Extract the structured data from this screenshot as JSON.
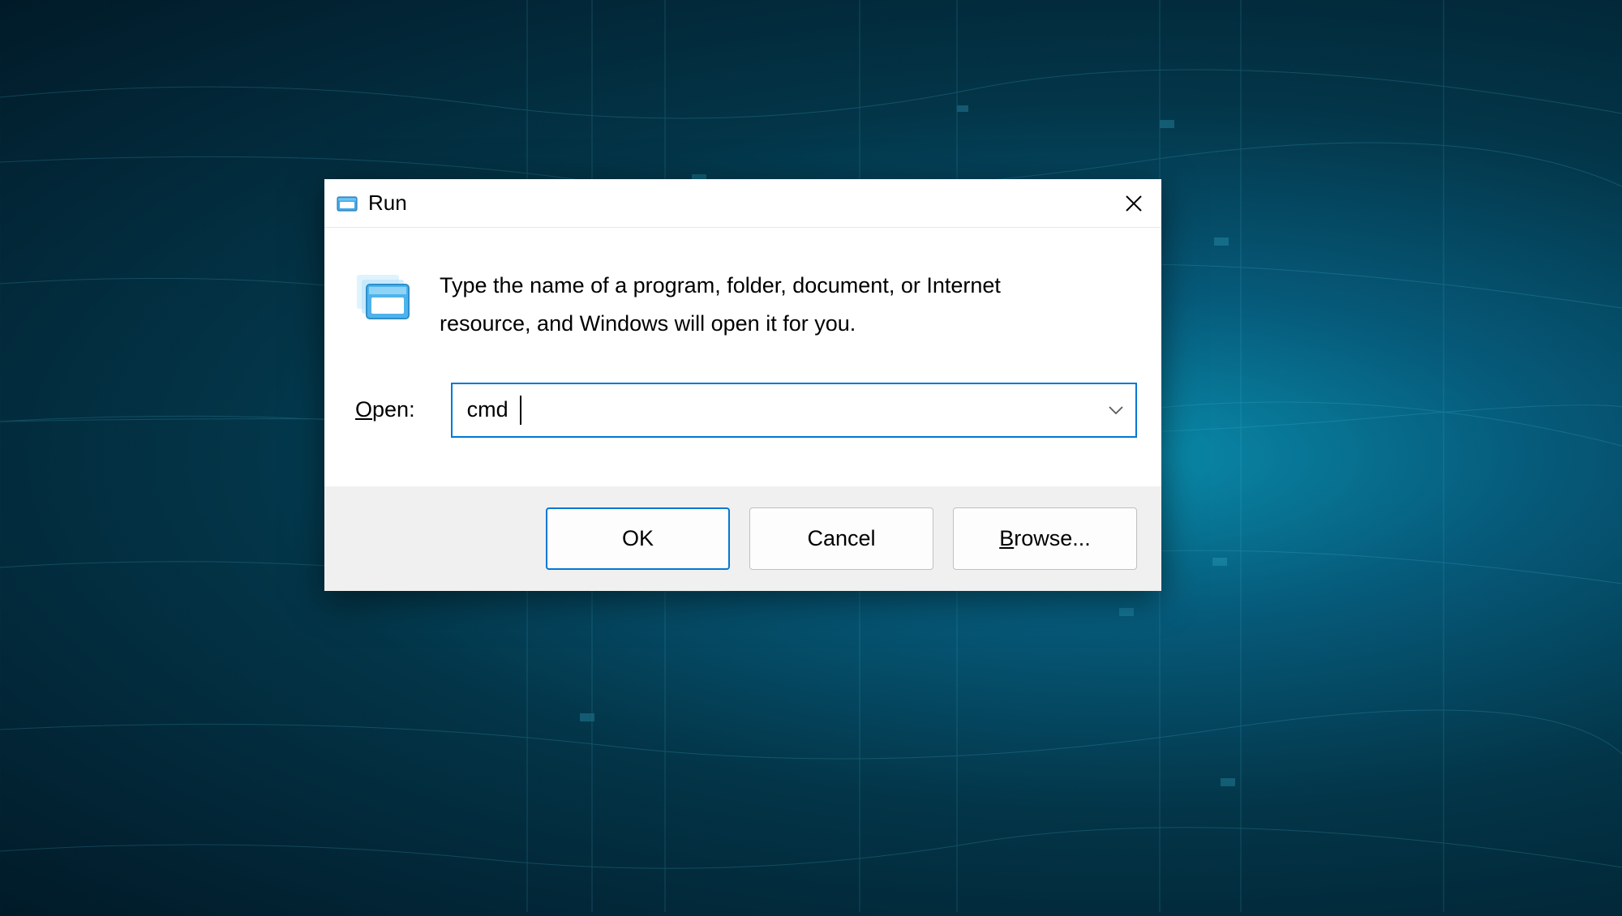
{
  "titlebar": {
    "title": "Run"
  },
  "body": {
    "description": "Type the name of a program, folder, document, or Internet resource, and Windows will open it for you.",
    "open_label_prefix": "O",
    "open_label_suffix": "pen:",
    "input_value": "cmd"
  },
  "buttons": {
    "ok": "OK",
    "cancel": "Cancel",
    "browse_prefix": "B",
    "browse_suffix": "rowse..."
  }
}
